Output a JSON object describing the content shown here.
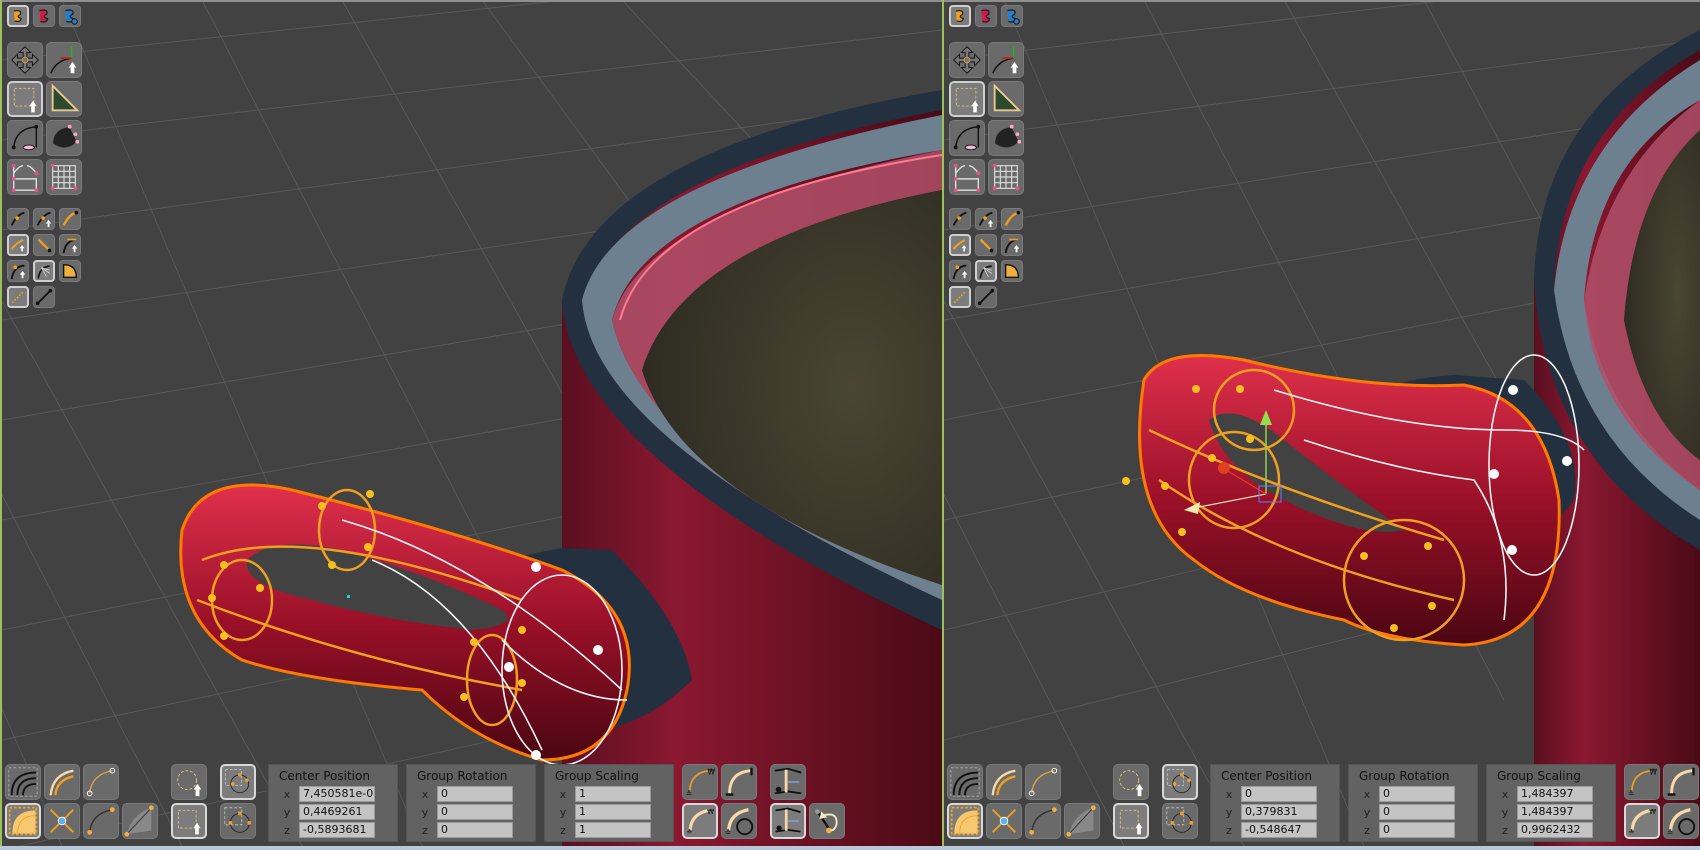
{
  "app": {
    "accent_border": "#9cc05a",
    "viewport_bg": "#424242"
  },
  "viewports": [
    {
      "name": "left",
      "transform_panels": {
        "center_position": {
          "title": "Center Position",
          "x": "7,450581e-0",
          "y": "0,4469261",
          "z": "-0,5893681"
        },
        "group_rotation": {
          "title": "Group Rotation",
          "x": "0",
          "y": "0",
          "z": "0"
        },
        "group_scaling": {
          "title": "Group Scaling",
          "x": "1",
          "y": "1",
          "z": "1"
        }
      }
    },
    {
      "name": "right",
      "transform_panels": {
        "center_position": {
          "title": "Center Position",
          "x": "0",
          "y": "0,379831",
          "z": "-0,548647"
        },
        "group_rotation": {
          "title": "Group Rotation",
          "x": "0",
          "y": "0",
          "z": "0"
        },
        "group_scaling": {
          "title": "Group Scaling",
          "x": "1,484397",
          "y": "1,484397",
          "z": "0,9962432"
        }
      }
    }
  ],
  "axis_labels": {
    "x": "x",
    "y": "y",
    "z": "z"
  },
  "toolbar_icons": {
    "modes": [
      "curve-mode-orange-icon",
      "curve-mode-red-icon",
      "curve-mode-blue-add-icon"
    ],
    "tools": [
      "move-icon",
      "curve-axis-select-icon",
      "rect-select-icon",
      "triangle-ruler-icon",
      "profile-sweep-icon",
      "shell-surface-icon",
      "bridge-icon",
      "grid-surface-icon"
    ],
    "curve_tools": [
      "curve-point-icon",
      "curve-point-select-icon",
      "curve-arc-icon",
      "curve-handle-select-icon",
      "line-segment-icon",
      "curve-tangent-select-icon",
      "curve-insert-icon",
      "curve-fan-icon",
      "patch-fill-icon",
      "dotted-line-icon",
      "straight-line-icon"
    ]
  },
  "bottom_icons": [
    "surface-stack-icon",
    "offset-curves-icon",
    "curve-endpoint-icon",
    "fill-quarter-icon",
    "scale-arrows-icon",
    "curve-points-icon",
    "sector-icon",
    "lasso-circle-icon",
    "rect-select-icon",
    "circle-points-box-icon",
    "circle-points-box-alt-icon",
    "constraint-curve-icon",
    "constraint-arc-icon",
    "constraint-curve-thick-icon",
    "constraint-circle-icon",
    "mirror-plane-icon",
    "mirror-plane-alt-icon",
    "rotate-handle-icon"
  ]
}
